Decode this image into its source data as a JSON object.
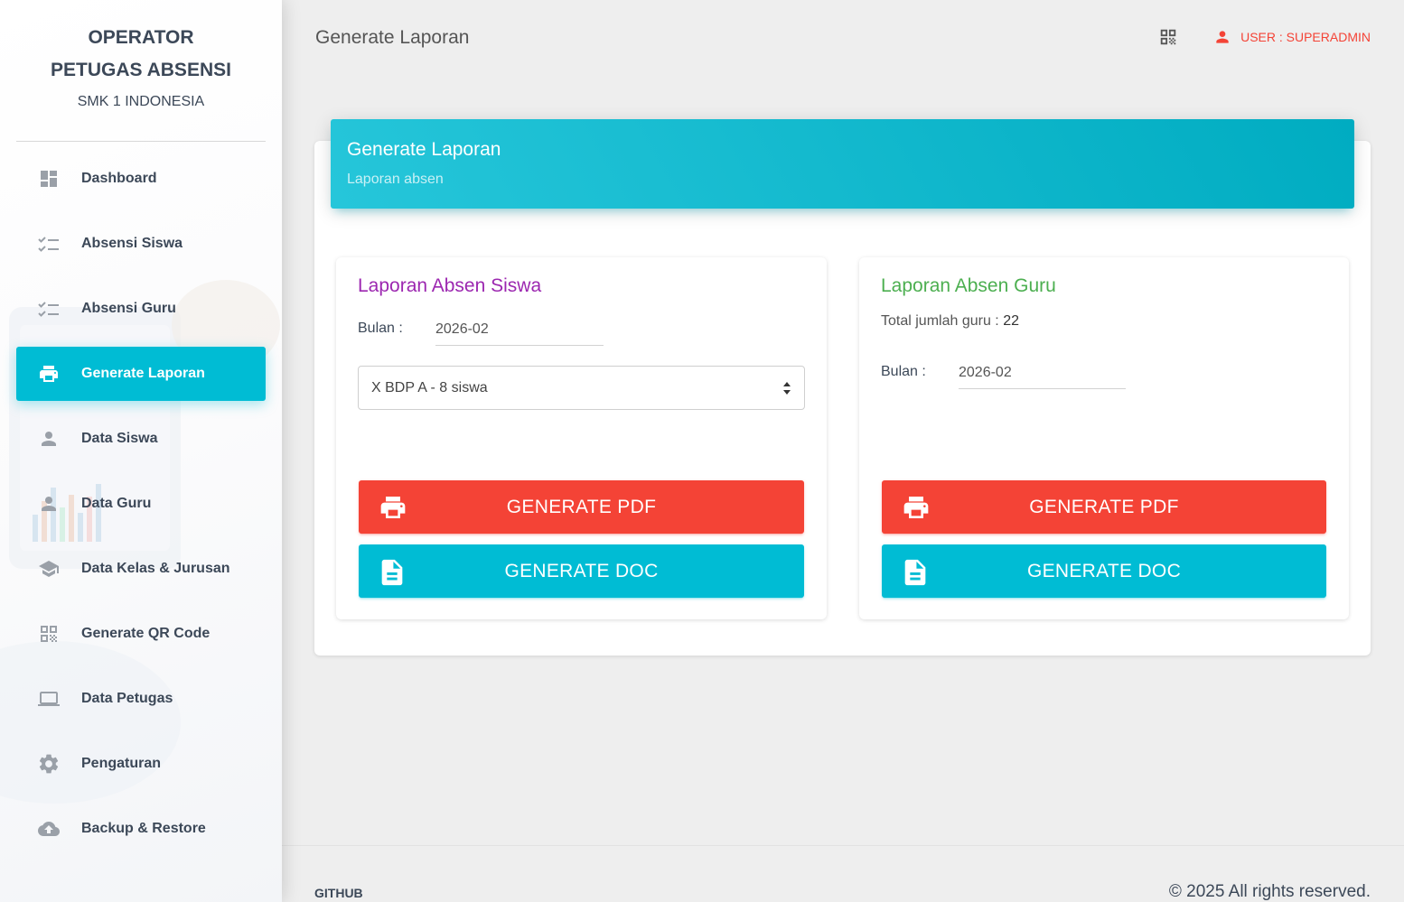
{
  "sidebar": {
    "brand_line1": "OPERATOR",
    "brand_line2": "PETUGAS ABSENSI",
    "brand_line3": "SMK 1 INDONESIA",
    "items": [
      {
        "label": "Dashboard",
        "icon": "dashboard-icon"
      },
      {
        "label": "Absensi Siswa",
        "icon": "checklist-icon"
      },
      {
        "label": "Absensi Guru",
        "icon": "checklist-icon"
      },
      {
        "label": "Generate Laporan",
        "icon": "printer-icon",
        "active": true
      },
      {
        "label": "Data Siswa",
        "icon": "person-icon"
      },
      {
        "label": "Data Guru",
        "icon": "person-icon"
      },
      {
        "label": "Data Kelas & Jurusan",
        "icon": "school-icon"
      },
      {
        "label": "Generate QR Code",
        "icon": "qr-code-icon"
      },
      {
        "label": "Data Petugas",
        "icon": "laptop-icon"
      },
      {
        "label": "Pengaturan",
        "icon": "gear-icon"
      },
      {
        "label": "Backup & Restore",
        "icon": "cloud-upload-icon"
      }
    ],
    "active_color": "#00bcd4"
  },
  "topbar": {
    "title": "Generate Laporan",
    "user_label": "USER : SUPERADMIN",
    "user_color": "#f44336"
  },
  "card": {
    "title": "Generate Laporan",
    "subtitle": "Laporan absen"
  },
  "siswa": {
    "title": "Laporan Absen Siswa",
    "bulan_label": "Bulan :",
    "bulan_value": "2026-02",
    "kelas_selected": "X BDP A - 8 siswa",
    "pdf_label": "GENERATE PDF",
    "doc_label": "GENERATE DOC"
  },
  "guru": {
    "title": "Laporan Absen Guru",
    "total_label": "Total jumlah guru : ",
    "total_value": "22",
    "bulan_label": "Bulan :",
    "bulan_value": "2026-02",
    "pdf_label": "GENERATE PDF",
    "doc_label": "GENERATE DOC"
  },
  "footer": {
    "link": "GITHUB",
    "copyright": "© 2025 All rights reserved."
  },
  "colors": {
    "purple": "#9c27b0",
    "green": "#4caf50",
    "red": "#f44336",
    "cyan": "#00bcd4"
  }
}
